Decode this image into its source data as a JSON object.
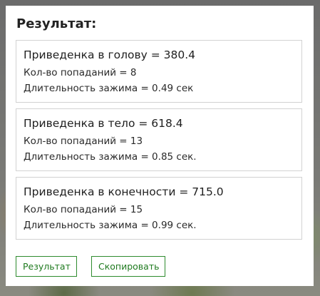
{
  "panel": {
    "title": "Результат:"
  },
  "cards": [
    {
      "heading": "Приведенка в голову = 380.4",
      "hits": "Кол-во попаданий = 8",
      "duration": "Длительность зажима = 0.49 сек"
    },
    {
      "heading": "Приведенка в тело = 618.4",
      "hits": "Кол-во попаданий = 13",
      "duration": "Длительность зажима = 0.85 сек."
    },
    {
      "heading": "Приведенка в конечности = 715.0",
      "hits": "Кол-во попаданий = 15",
      "duration": "Длительность зажима = 0.99 сек."
    }
  ],
  "buttons": {
    "result_label": "Результат",
    "copy_label": "Скопировать"
  },
  "colors": {
    "button_border": "#2e8b2e",
    "button_text": "#1f7a1f",
    "card_border": "#d2d2d2"
  }
}
